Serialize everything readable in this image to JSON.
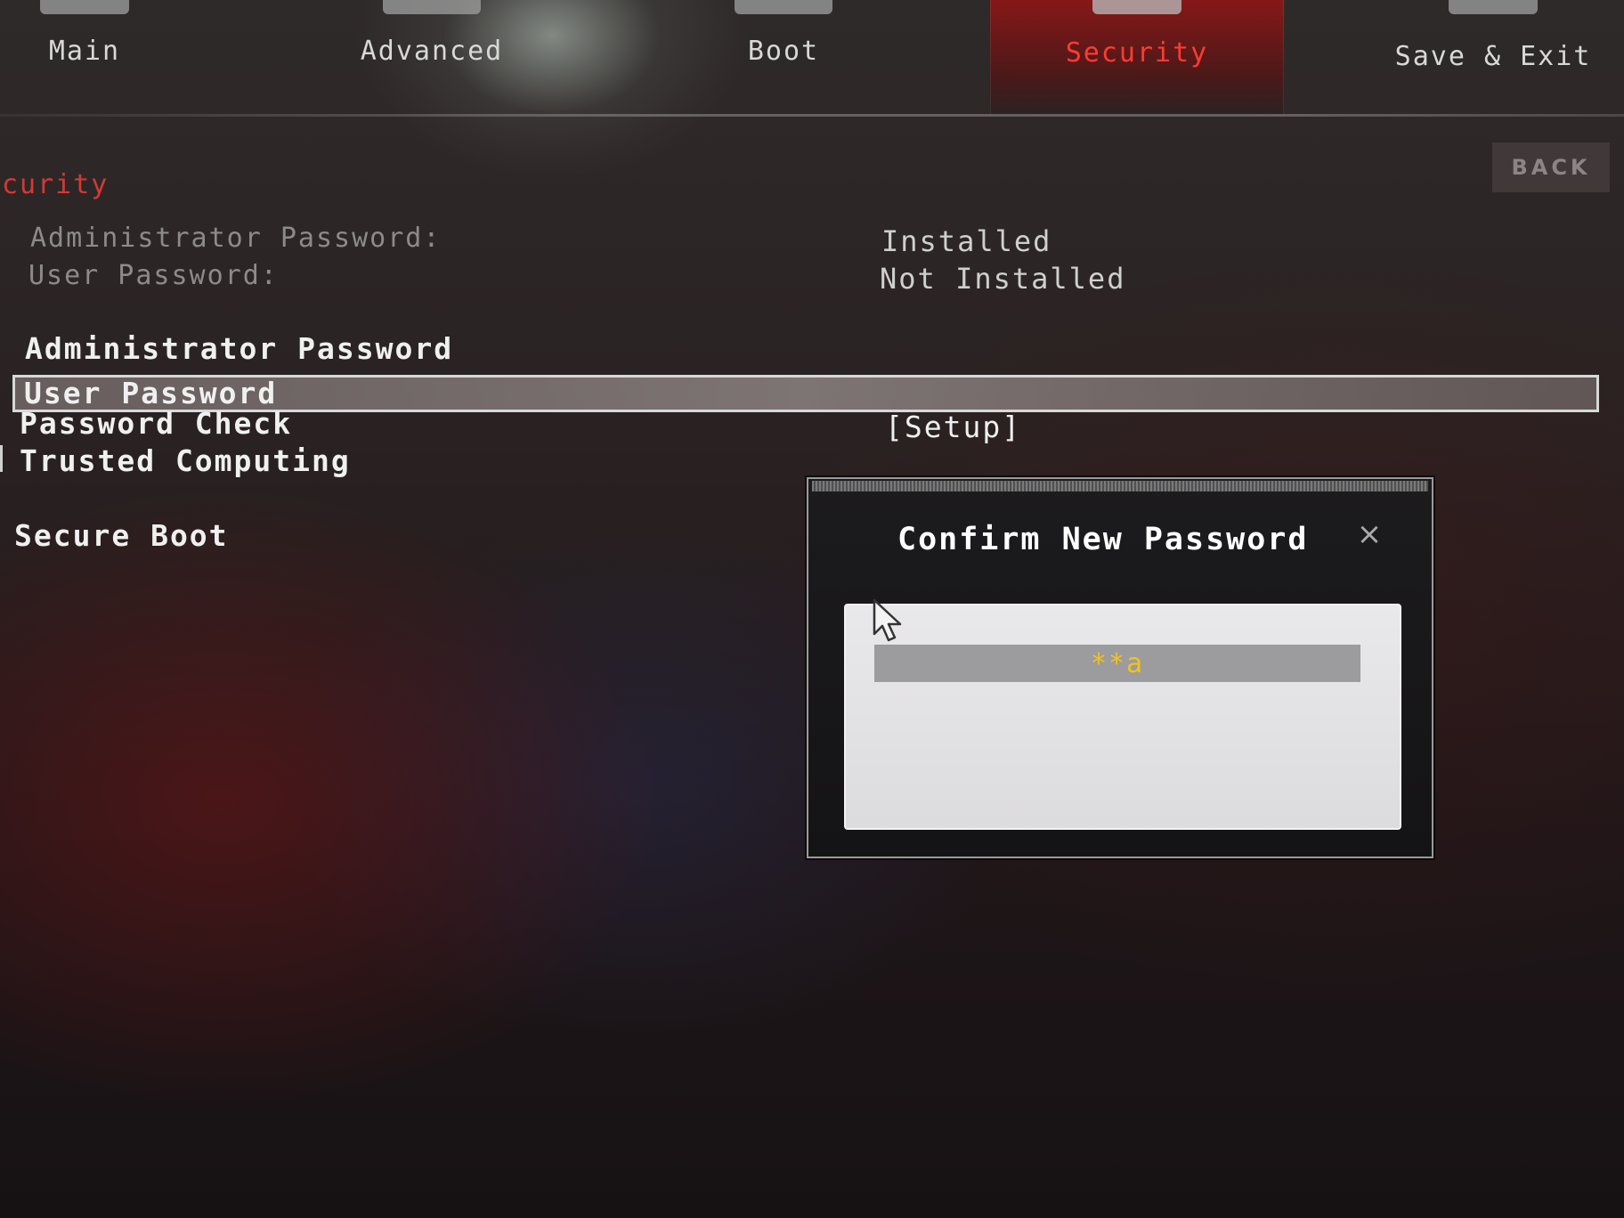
{
  "tabs": [
    {
      "label": "Main",
      "active": false
    },
    {
      "label": "Advanced",
      "active": false
    },
    {
      "label": "Boot",
      "active": false
    },
    {
      "label": "Security",
      "active": true
    },
    {
      "label": "Save & Exit",
      "active": false
    }
  ],
  "back_label": "BACK",
  "section_title": "curity",
  "info": {
    "admin_label": "Administrator Password:",
    "admin_value": "Installed",
    "user_label": "User Password:",
    "user_value": "Not Installed"
  },
  "menu": {
    "admin_password": "Administrator Password",
    "user_password": "User Password",
    "password_check": "Password Check",
    "password_check_value": "[Setup]",
    "trusted_computing": "Trusted Computing",
    "secure_boot": "Secure Boot"
  },
  "dialog": {
    "title": "Confirm New Password",
    "close_glyph": "×",
    "field_value": "**a"
  },
  "colors": {
    "accent": "#ff3b32",
    "section_title": "#d23a33",
    "field_text": "#f2c21f"
  }
}
